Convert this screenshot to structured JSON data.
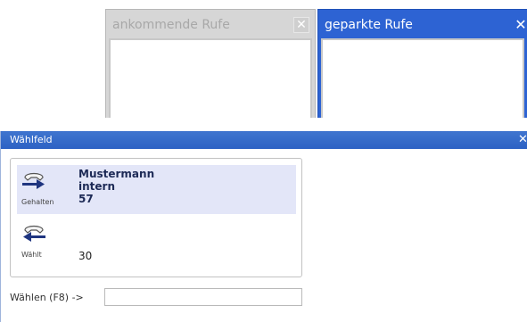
{
  "panels": {
    "incoming": {
      "title": "ankommende Rufe",
      "close_glyph": "✕"
    },
    "parked": {
      "title": "geparkte Rufe",
      "close_glyph": "✕"
    }
  },
  "dial_window": {
    "title": "Wählfeld",
    "close_glyph": "✕",
    "calls": [
      {
        "state": "Gehalten",
        "name": "Mustermann",
        "detail": "intern",
        "number": "57",
        "icon": "held-call-icon"
      },
      {
        "state": "Wählt",
        "name": "",
        "detail": "",
        "number": "30",
        "icon": "dialing-call-icon"
      }
    ],
    "dial_label": "Wählen (F8) ->",
    "dial_input_value": ""
  },
  "colors": {
    "title_blue": "#2d62c4",
    "held_row_bg": "#e3e6f8",
    "inactive_panel": "#d6d6d6"
  }
}
